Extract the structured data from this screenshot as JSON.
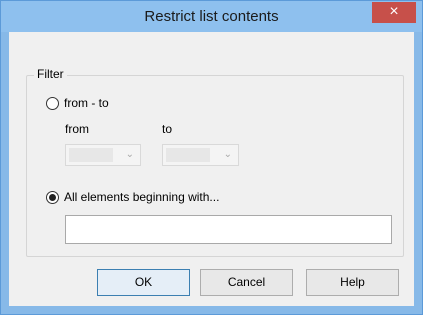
{
  "window": {
    "title": "Restrict list contents",
    "close_glyph": "×"
  },
  "filter": {
    "group_label": "Filter",
    "range_option": {
      "label": "from - to",
      "selected": false
    },
    "from_label": "from",
    "to_label": "to",
    "from_value": "",
    "to_value": "",
    "begins_option": {
      "label": "All elements beginning with...",
      "selected": true
    },
    "begins_value": ""
  },
  "buttons": {
    "ok": "OK",
    "cancel": "Cancel",
    "help": "Help"
  },
  "icons": {
    "close": "close-icon",
    "dropdown": "chevron-down-icon"
  },
  "colors": {
    "titlebar": "#8ec0ee",
    "close_button": "#c7504a",
    "dialog_background": "#f0f0f0"
  }
}
